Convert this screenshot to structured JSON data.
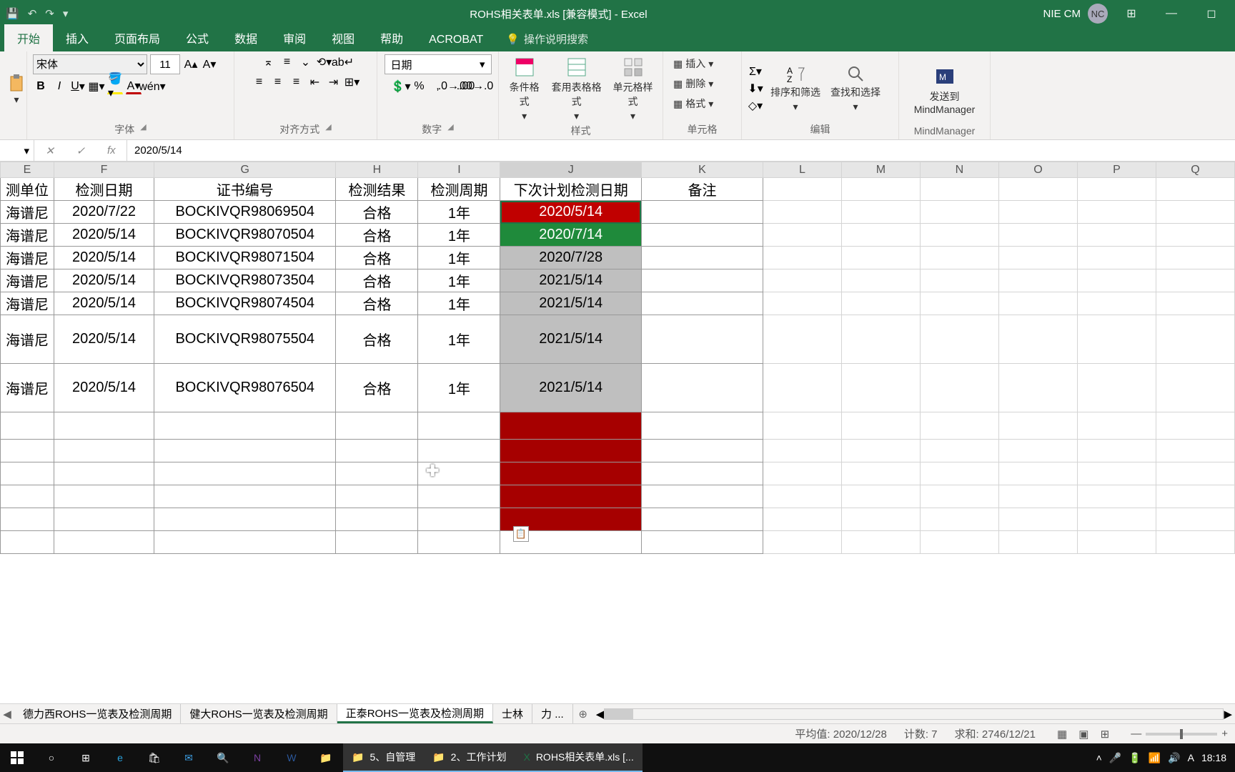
{
  "titlebar": {
    "title": "ROHS相关表单.xls  [兼容模式]  -  Excel",
    "user_name": "NIE CM",
    "user_initials": "NC"
  },
  "tabs": {
    "items": [
      "开始",
      "插入",
      "页面布局",
      "公式",
      "数据",
      "审阅",
      "视图",
      "帮助",
      "ACROBAT"
    ],
    "tell_me": "操作说明搜索"
  },
  "ribbon": {
    "font_name": "宋体",
    "font_size": "11",
    "number_format": "日期",
    "groups": {
      "font": "字体",
      "align": "对齐方式",
      "number": "数字",
      "styles": "样式",
      "cells": "单元格",
      "editing": "编辑",
      "mm": "MindManager"
    },
    "btn": {
      "cond": "条件格式",
      "tbl": "套用表格格式",
      "cellstyle": "单元格样式",
      "insert": "插入",
      "delete": "删除",
      "format": "格式",
      "sort": "排序和筛选",
      "find": "查找和选择",
      "mm": "发送到MindManager"
    }
  },
  "formula_bar": {
    "cell_ref": "",
    "value": "2020/5/14"
  },
  "columns": [
    "E",
    "F",
    "G",
    "H",
    "I",
    "J",
    "K",
    "L",
    "M",
    "N",
    "O",
    "P",
    "Q"
  ],
  "headers": {
    "E": "测单位",
    "F": "检测日期",
    "G": "证书编号",
    "H": "检测结果",
    "I": "检测周期",
    "J": "下次计划检测日期",
    "K": "备注"
  },
  "rows": [
    {
      "E": "海谱尼",
      "F": "2020/7/22",
      "G": "BOCKIVQR98069504",
      "H": "合格",
      "I": "1年",
      "J": "2020/5/14",
      "Jc": "red"
    },
    {
      "E": "海谱尼",
      "F": "2020/5/14",
      "G": "BOCKIVQR98070504",
      "H": "合格",
      "I": "1年",
      "J": "2020/7/14",
      "Jc": "green"
    },
    {
      "E": "海谱尼",
      "F": "2020/5/14",
      "G": "BOCKIVQR98071504",
      "H": "合格",
      "I": "1年",
      "J": "2020/7/28",
      "Jc": "gray"
    },
    {
      "E": "海谱尼",
      "F": "2020/5/14",
      "G": "BOCKIVQR98073504",
      "H": "合格",
      "I": "1年",
      "J": "2021/5/14",
      "Jc": "gray"
    },
    {
      "E": "海谱尼",
      "F": "2020/5/14",
      "G": "BOCKIVQR98074504",
      "H": "合格",
      "I": "1年",
      "J": "2021/5/14",
      "Jc": "gray"
    },
    {
      "E": "海谱尼",
      "F": "2020/5/14",
      "G": "BOCKIVQR98075504",
      "H": "合格",
      "I": "1年",
      "J": "2021/5/14",
      "Jc": "gray",
      "tall": true
    },
    {
      "E": "海谱尼",
      "F": "2020/5/14",
      "G": "BOCKIVQR98076504",
      "H": "合格",
      "I": "1年",
      "J": "2021/5/14",
      "Jc": "gray",
      "tall": true
    },
    {
      "E": "",
      "F": "",
      "G": "",
      "H": "",
      "I": "",
      "J": "",
      "Jc": "darkred",
      "htall": true
    },
    {
      "E": "",
      "F": "",
      "G": "",
      "H": "",
      "I": "",
      "J": "",
      "Jc": "darkred"
    },
    {
      "E": "",
      "F": "",
      "G": "",
      "H": "",
      "I": "",
      "J": "",
      "Jc": "darkred"
    },
    {
      "E": "",
      "F": "",
      "G": "",
      "H": "",
      "I": "",
      "J": "",
      "Jc": "darkred"
    },
    {
      "E": "",
      "F": "",
      "G": "",
      "H": "",
      "I": "",
      "J": "",
      "Jc": "darkred"
    },
    {
      "E": "",
      "F": "",
      "G": "",
      "H": "",
      "I": "",
      "J": "",
      "Jc": ""
    }
  ],
  "sheet_tabs": {
    "items": [
      "德力西ROHS一览表及检测周期",
      "健大ROHS一览表及检测周期",
      "正泰ROHS一览表及检测周期",
      "士林",
      "力 ..."
    ],
    "active": 2
  },
  "status": {
    "avg_label": "平均值:",
    "avg": "2020/12/28",
    "cnt_label": "计数:",
    "cnt": "7",
    "sum_label": "求和:",
    "sum": "2746/12/21"
  },
  "taskbar": {
    "folders": [
      "5、自管理",
      "2、工作计划"
    ],
    "excel": "ROHS相关表单.xls  [...",
    "time": "18:18"
  },
  "col_widths": {
    "E": 60,
    "F": 112,
    "G": 180,
    "H": 92,
    "I": 92,
    "J": 158,
    "K": 136,
    "rest": 88
  }
}
